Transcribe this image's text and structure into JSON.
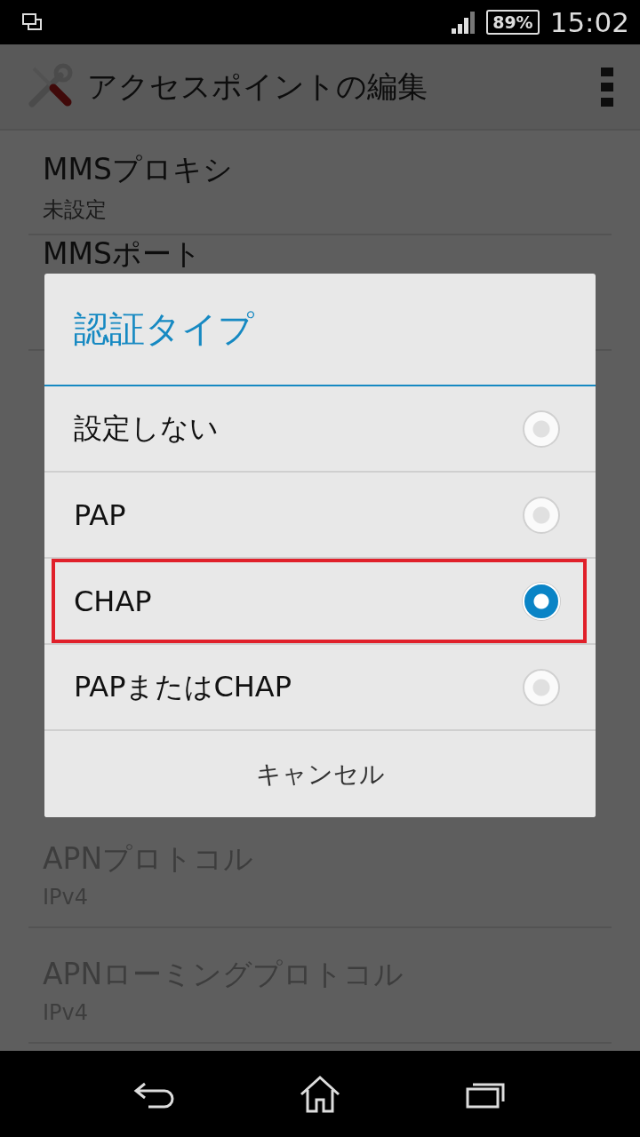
{
  "status_bar": {
    "battery": "89%",
    "time": "15:02"
  },
  "app_bar": {
    "title": "アクセスポイントの編集"
  },
  "settings": [
    {
      "title": "MMSプロキシ",
      "summary": "未設定",
      "disabled": false
    },
    {
      "title": "MMSポート",
      "disabled": false
    },
    {
      "kind": "hidden"
    },
    {
      "title": "APNプロトコル",
      "summary": "IPv4",
      "disabled": true
    },
    {
      "title": "APNローミングプロトコル",
      "summary": "IPv4",
      "disabled": true
    }
  ],
  "dialog": {
    "title": "認証タイプ",
    "options": [
      {
        "label": "設定しない",
        "selected": false,
        "highlighted": false
      },
      {
        "label": "PAP",
        "selected": false,
        "highlighted": false
      },
      {
        "label": "CHAP",
        "selected": true,
        "highlighted": true
      },
      {
        "label": "PAPまたはCHAP",
        "selected": false,
        "highlighted": false
      }
    ],
    "cancel": "キャンセル"
  }
}
